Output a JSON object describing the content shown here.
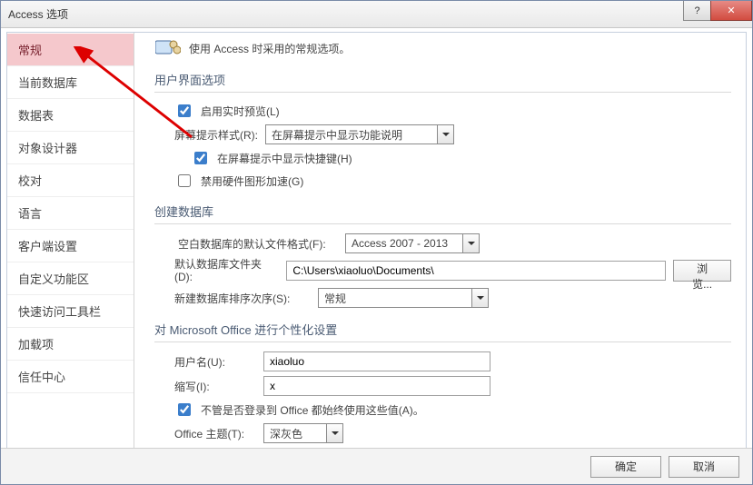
{
  "window": {
    "title": "Access 选项"
  },
  "sidebar": {
    "items": [
      {
        "label": "常规",
        "selected": true
      },
      {
        "label": "当前数据库"
      },
      {
        "label": "数据表"
      },
      {
        "label": "对象设计器"
      },
      {
        "label": "校对"
      },
      {
        "label": "语言"
      },
      {
        "label": "客户端设置"
      },
      {
        "label": "自定义功能区"
      },
      {
        "label": "快速访问工具栏"
      },
      {
        "label": "加载项"
      },
      {
        "label": "信任中心"
      }
    ]
  },
  "content": {
    "top_desc": "使用 Access 时采用的常规选项。",
    "section_ui": {
      "title": "用户界面选项",
      "realtime_preview": {
        "checked": true,
        "label": "启用实时预览(L)"
      },
      "screen_tip_style": {
        "label": "屏幕提示样式(R):",
        "value": "在屏幕提示中显示功能说明"
      },
      "show_shortcut": {
        "checked": true,
        "label": "在屏幕提示中显示快捷键(H)"
      },
      "disable_hw_gfx": {
        "checked": false,
        "label": "禁用硬件图形加速(G)"
      }
    },
    "section_createdb": {
      "title": "创建数据库",
      "default_format": {
        "label": "空白数据库的默认文件格式(F):",
        "value": "Access 2007 - 2013"
      },
      "default_folder": {
        "label": "默认数据库文件夹(D):",
        "value": "C:\\Users\\xiaoluo\\Documents\\",
        "browse": "浏览..."
      },
      "sort_order": {
        "label": "新建数据库排序次序(S):",
        "value": "常规"
      }
    },
    "section_personalize": {
      "title": "对 Microsoft Office 进行个性化设置",
      "username": {
        "label": "用户名(U):",
        "value": "xiaoluo"
      },
      "initials": {
        "label": "缩写(I):",
        "value": "x"
      },
      "always_use": {
        "checked": true,
        "label": "不管是否登录到 Office 都始终使用这些值(A)。"
      },
      "theme": {
        "label": "Office 主题(T):",
        "value": "深灰色"
      }
    }
  },
  "footer": {
    "ok": "确定",
    "cancel": "取消"
  }
}
